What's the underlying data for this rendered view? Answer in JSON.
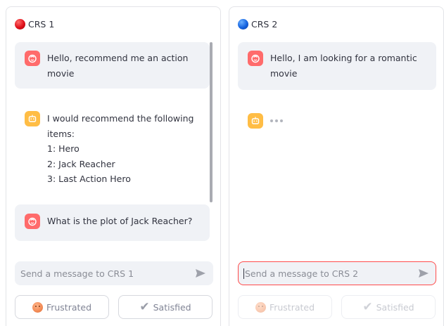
{
  "panels": [
    {
      "title": "CRS 1",
      "indicator_color": "#e0101a",
      "messages": [
        {
          "role": "user",
          "icon": "user-face-icon",
          "text": "Hello, recommend me an action movie"
        },
        {
          "role": "bot",
          "icon": "robot-icon",
          "text": "I would recommend the following items:\n1: Hero\n2: Jack Reacher\n3: Last Action Hero"
        },
        {
          "role": "user",
          "icon": "user-face-icon",
          "text": "What is the plot of Jack Reacher?"
        }
      ],
      "input": {
        "placeholder": "Send a message to CRS 1",
        "focused": false
      },
      "buttons": {
        "frustrated": "Frustrated",
        "satisfied": "Satisfied",
        "disabled": false
      }
    },
    {
      "title": "CRS 2",
      "indicator_color": "#1463e0",
      "messages": [
        {
          "role": "user",
          "icon": "user-face-icon",
          "text": "Hello, I am looking for a romantic movie"
        },
        {
          "role": "bot",
          "icon": "robot-icon",
          "typing": true
        }
      ],
      "input": {
        "placeholder": "Send a message to CRS 2",
        "focused": true
      },
      "buttons": {
        "frustrated": "Frustrated",
        "satisfied": "Satisfied",
        "disabled": true
      }
    }
  ],
  "colors": {
    "user_avatar": "#ff6b6b",
    "bot_avatar": "#ffbd45",
    "focus_border": "#ff4b4b",
    "message_bg": "#f0f2f6"
  }
}
